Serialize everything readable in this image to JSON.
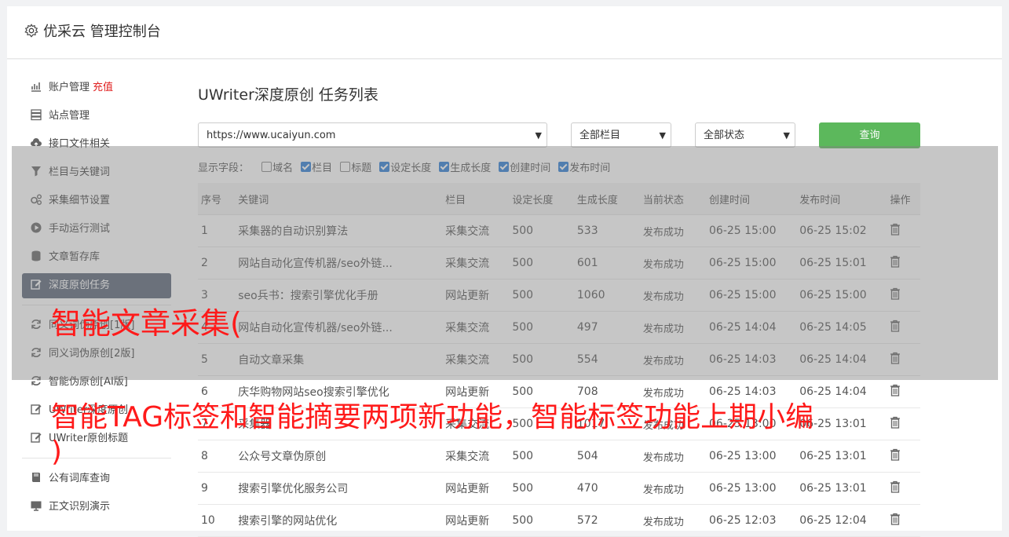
{
  "header": {
    "title": "优采云 管理控制台"
  },
  "sidebar": {
    "items": [
      {
        "label": "账户管理",
        "extra": "充值",
        "icon": "bar-chart-icon"
      },
      {
        "label": "站点管理",
        "icon": "server-icon"
      },
      {
        "label": "接口文件相关",
        "icon": "cloud-upload-icon"
      },
      {
        "label": "栏目与关键词",
        "icon": "filter-icon"
      },
      {
        "label": "采集细节设置",
        "icon": "gears-icon"
      },
      {
        "label": "手动运行测试",
        "icon": "play-circle-icon"
      },
      {
        "label": "文章暂存库",
        "icon": "database-icon"
      },
      {
        "label": "深度原创任务",
        "icon": "edit-icon",
        "active": true
      },
      {
        "label": "同义词伪原创[1版]",
        "icon": "refresh-icon"
      },
      {
        "label": "同义词伪原创[2版]",
        "icon": "refresh-icon"
      },
      {
        "label": "智能伪原创[AI版]",
        "icon": "refresh-icon"
      },
      {
        "label": "UWriter深度原创",
        "icon": "edit-icon"
      },
      {
        "label": "UWriter原创标题",
        "icon": "edit-icon"
      },
      {
        "label": "公有词库查询",
        "icon": "book-icon"
      },
      {
        "label": "正文识别演示",
        "icon": "monitor-icon"
      }
    ]
  },
  "page": {
    "heading": "UWriter深度原创 任务列表",
    "site_select": "https://www.ucaiyun.com",
    "column_select": "全部栏目",
    "status_select": "全部状态",
    "query_label": "查询",
    "fields_label": "显示字段：",
    "fields": [
      {
        "label": "域名",
        "checked": false
      },
      {
        "label": "栏目",
        "checked": true
      },
      {
        "label": "标题",
        "checked": false
      },
      {
        "label": "设定长度",
        "checked": true
      },
      {
        "label": "生成长度",
        "checked": true
      },
      {
        "label": "创建时间",
        "checked": true
      },
      {
        "label": "发布时间",
        "checked": true
      }
    ]
  },
  "table": {
    "headers": [
      "序号",
      "关键词",
      "栏目",
      "设定长度",
      "生成长度",
      "当前状态",
      "创建时间",
      "发布时间",
      "操作"
    ],
    "rows": [
      [
        "1",
        "采集器的自动识别算法",
        "采集交流",
        "500",
        "533",
        "发布成功",
        "06-25 15:00",
        "06-25 15:02"
      ],
      [
        "2",
        "网站自动化宣传机器/seo外链...",
        "采集交流",
        "500",
        "601",
        "发布成功",
        "06-25 15:00",
        "06-25 15:01"
      ],
      [
        "3",
        "seo兵书：搜索引擎优化手册",
        "网站更新",
        "500",
        "1060",
        "发布成功",
        "06-25 15:00",
        "06-25 15:00"
      ],
      [
        "4",
        "网站自动化宣传机器/seo外链...",
        "采集交流",
        "500",
        "497",
        "发布成功",
        "06-25 14:04",
        "06-25 14:05"
      ],
      [
        "5",
        "自动文章采集",
        "采集交流",
        "500",
        "554",
        "发布成功",
        "06-25 14:03",
        "06-25 14:04"
      ],
      [
        "6",
        "庆华购物网站seo搜索引擎优化",
        "网站更新",
        "500",
        "708",
        "发布成功",
        "06-25 14:03",
        "06-25 14:04"
      ],
      [
        "7",
        "采集器",
        "采集交流",
        "500",
        "1017",
        "发布成功",
        "06-25 13:00",
        "06-25 13:01"
      ],
      [
        "8",
        "公众号文章伪原创",
        "采集交流",
        "500",
        "504",
        "发布成功",
        "06-25 13:00",
        "06-25 13:01"
      ],
      [
        "9",
        "搜索引擎优化服务公司",
        "网站更新",
        "500",
        "470",
        "发布成功",
        "06-25 13:00",
        "06-25 13:01"
      ],
      [
        "10",
        "搜索引擎的网站优化",
        "网站更新",
        "500",
        "572",
        "发布成功",
        "06-25 12:03",
        "06-25 12:04"
      ]
    ]
  },
  "overlay": {
    "caption1": "智能文章采集(",
    "caption2": "智能TAG标签和智能摘要两项新功能，智能标签功能上期小编",
    "caption3": ")"
  }
}
